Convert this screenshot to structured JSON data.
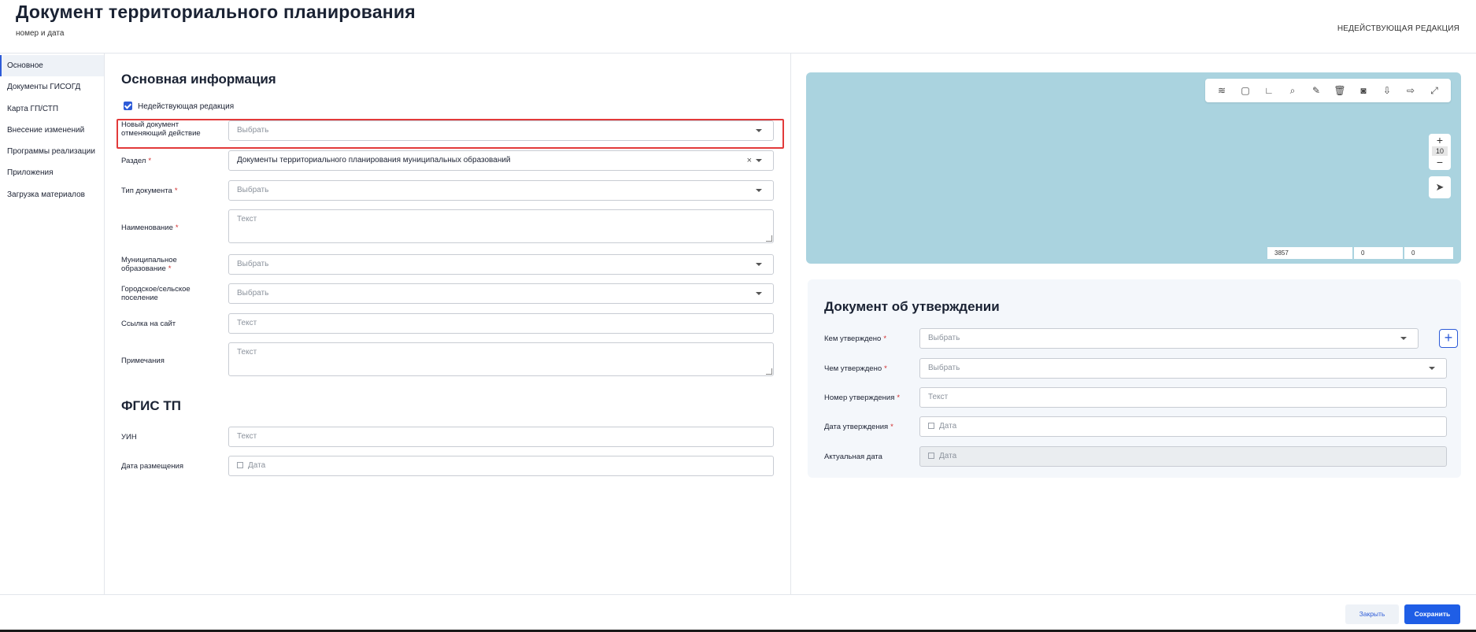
{
  "header": {
    "title": "Документ территориального планирования",
    "subtitle": "номер и дата",
    "status": "НЕДЕЙСТВУЮЩАЯ РЕДАКЦИЯ"
  },
  "sidebar": {
    "items": [
      {
        "label": "Основное",
        "active": true
      },
      {
        "label": "Документы ГИСОГД"
      },
      {
        "label": "Карта ГП/СТП"
      },
      {
        "label": "Внесение изменений"
      },
      {
        "label": "Программы реализации"
      },
      {
        "label": "Приложения"
      },
      {
        "label": "Загрузка материалов"
      }
    ]
  },
  "main_info": {
    "title": "Основная информация",
    "checkbox_label": "Недействующая редакция",
    "checkbox_checked": true,
    "fields": {
      "new_doc": {
        "label": "Новый документ отменяющий действие",
        "placeholder": "Выбрать"
      },
      "section": {
        "label": "Раздел",
        "value": "Документы территориального планирования муниципальных образований"
      },
      "doc_type": {
        "label": "Тип документа",
        "placeholder": "Выбрать"
      },
      "name": {
        "label": "Наименование",
        "placeholder": "Текст"
      },
      "municipality": {
        "label": "Муниципальное образование",
        "placeholder": "Выбрать"
      },
      "settlement": {
        "label": "Городское/сельское поселение",
        "placeholder": "Выбрать"
      },
      "site_link": {
        "label": "Ссылка на сайт",
        "placeholder": "Текст"
      },
      "notes": {
        "label": "Примечания",
        "placeholder": "Текст"
      }
    }
  },
  "fgis": {
    "title": "ФГИС ТП",
    "uin": {
      "label": "УИН",
      "placeholder": "Текст"
    },
    "placement_date": {
      "label": "Дата размещения",
      "placeholder": "Дата"
    }
  },
  "map": {
    "tools": [
      "layers-icon",
      "select-area-icon",
      "measure-icon",
      "search-icon",
      "edit-icon",
      "delete-icon",
      "camera-icon",
      "import-icon",
      "export-icon",
      "fullscreen-icon"
    ],
    "zoom_level": "10",
    "coords": {
      "srid": "3857",
      "x": "0",
      "y": "0"
    }
  },
  "approval": {
    "title": "Документ об утверждении",
    "approved_by": {
      "label": "Кем утверждено",
      "placeholder": "Выбрать"
    },
    "approved_with": {
      "label": "Чем утверждено",
      "placeholder": "Выбрать"
    },
    "number": {
      "label": "Номер утверждения",
      "placeholder": "Текст"
    },
    "date": {
      "label": "Дата утверждения",
      "placeholder": "Дата"
    },
    "actual_date": {
      "label": "Актуальная дата",
      "placeholder": "Дата"
    }
  },
  "footer": {
    "close_label": "Закрыть",
    "save_label": "Сохранить"
  },
  "colors": {
    "accent": "#1f5ee6",
    "highlight": "#e23a3a",
    "map_water": "#aad3df"
  }
}
